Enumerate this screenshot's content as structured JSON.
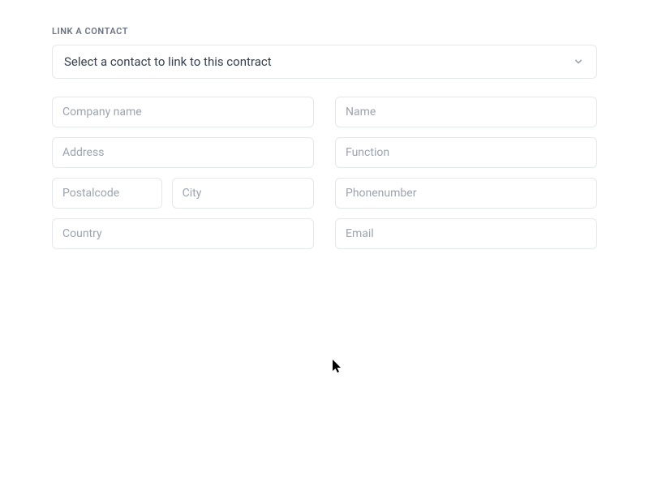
{
  "section": {
    "label": "LINK A CONTACT"
  },
  "dropdown": {
    "placeholder": "Select a contact to link to this contract"
  },
  "form": {
    "left": {
      "company": {
        "placeholder": "Company name",
        "value": ""
      },
      "address": {
        "placeholder": "Address",
        "value": ""
      },
      "postalcode": {
        "placeholder": "Postalcode",
        "value": ""
      },
      "city": {
        "placeholder": "City",
        "value": ""
      },
      "country": {
        "placeholder": "Country",
        "value": ""
      }
    },
    "right": {
      "name": {
        "placeholder": "Name",
        "value": ""
      },
      "function": {
        "placeholder": "Function",
        "value": ""
      },
      "phone": {
        "placeholder": "Phonenumber",
        "value": ""
      },
      "email": {
        "placeholder": "Email",
        "value": ""
      }
    }
  }
}
